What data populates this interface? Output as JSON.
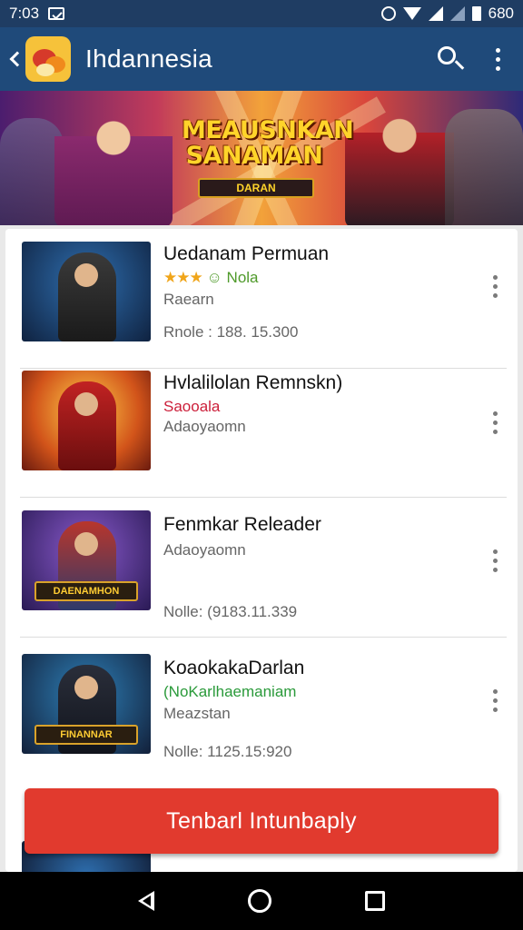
{
  "status_bar": {
    "time": "7:03",
    "battery_text": "680"
  },
  "app_bar": {
    "title": "Ihdannesia"
  },
  "banner": {
    "title": "MEAUSNKAN SANAMAN",
    "subtitle": "DARAN"
  },
  "games": [
    {
      "name": "Uedanam Permuan",
      "stars": "★★★",
      "rating_label": "☺ Nola",
      "category": "Raearn",
      "meta": "Rnole : 188. 15.300",
      "thumb_caption": ""
    },
    {
      "name": "Hvlalilolan Remnskn)",
      "subtitle": "Saooala",
      "category": "Adaoyaomn",
      "thumb_caption": ""
    },
    {
      "name": "Fenmkar Releader",
      "category": "Adaoyaomn",
      "meta": "Nolle: (9183.11.339",
      "thumb_caption": "DAENAMHON"
    },
    {
      "name": "KoaokakaDarlan",
      "subtitle": "(NoKarlhaemaniam",
      "category": "Meazstan",
      "meta": "Nolle: 1125.15:920",
      "thumb_caption": "FINANNAR"
    }
  ],
  "action_button": {
    "label": "Tenbarl Intunbaply"
  },
  "colors": {
    "app_bar": "#1f4a7a",
    "status_bar": "#1f3d63",
    "action": "#e13a2e",
    "star": "#f0a51a"
  }
}
